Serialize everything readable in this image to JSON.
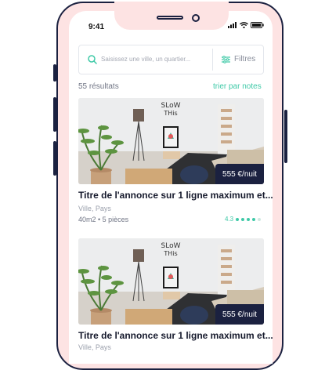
{
  "status_bar": {
    "time": "9:41"
  },
  "search": {
    "placeholder": "Saisissez une ville, un quartier...",
    "filter_label": "Filtres"
  },
  "results": {
    "count_label": "55 résultats",
    "sort_label": "trier par notes"
  },
  "listings": [
    {
      "price": "555 €/nuit",
      "title": "Titre de l'annonce sur 1 ligne maximum et...",
      "location": "Ville, Pays",
      "details": "40m2  •  5 pièces",
      "rating_value": "4.3",
      "rating_dots": 4,
      "rating_max": 5
    },
    {
      "price": "555 €/nuit",
      "title": "Titre de l'annonce sur 1 ligne maximum et...",
      "location": "Ville, Pays"
    }
  ],
  "colors": {
    "accent": "#3ec9a7",
    "navy": "#1b2140",
    "phone_frame": "#fde3e3"
  }
}
